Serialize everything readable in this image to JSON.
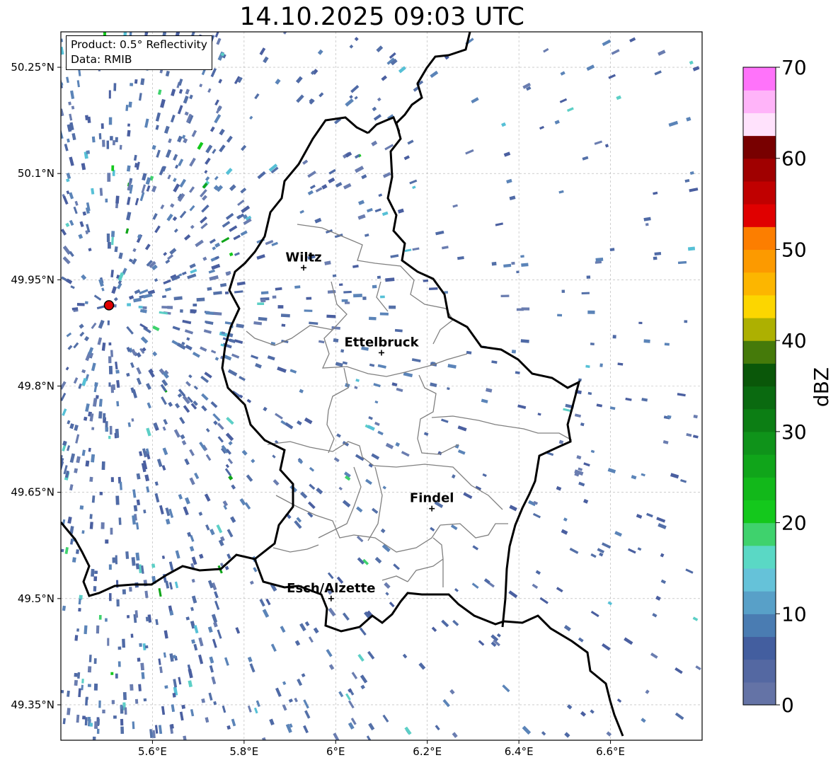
{
  "title": "14.10.2025 09:03 UTC",
  "info": {
    "product": "Product: 0.5° Reflectivity",
    "data": "Data: RMIB"
  },
  "map": {
    "lon_range": [
      5.4,
      6.8
    ],
    "lat_range": [
      49.3,
      50.3
    ],
    "x_ticks": [
      {
        "value": 5.6,
        "label": "5.6°E"
      },
      {
        "value": 5.8,
        "label": "5.8°E"
      },
      {
        "value": 6.0,
        "label": "6°E"
      },
      {
        "value": 6.2,
        "label": "6.2°E"
      },
      {
        "value": 6.4,
        "label": "6.4°E"
      },
      {
        "value": 6.6,
        "label": "6.6°E"
      }
    ],
    "y_ticks": [
      {
        "value": 50.25,
        "label": "50.25°N"
      },
      {
        "value": 50.1,
        "label": "50.1°N"
      },
      {
        "value": 49.95,
        "label": "49.95°N"
      },
      {
        "value": 49.8,
        "label": "49.8°N"
      },
      {
        "value": 49.65,
        "label": "49.65°N"
      },
      {
        "value": 49.5,
        "label": "49.5°N"
      },
      {
        "value": 49.35,
        "label": "49.35°N"
      }
    ],
    "cities": [
      {
        "name": "Wiltz",
        "lon": 5.93,
        "lat": 49.967
      },
      {
        "name": "Ettelbruck",
        "lon": 6.1,
        "lat": 49.847
      },
      {
        "name": "Findel",
        "lon": 6.21,
        "lat": 49.627
      },
      {
        "name": "Esch/Alzette",
        "lon": 5.99,
        "lat": 49.5
      }
    ],
    "radar_site": {
      "lon": 5.505,
      "lat": 49.914,
      "color": "#e00000"
    }
  },
  "colorbar": {
    "label": "dBZ",
    "min": 0,
    "max": 70,
    "tick_values": [
      0,
      10,
      20,
      30,
      40,
      50,
      60,
      70
    ],
    "colors": [
      "#6473a6",
      "#5468a2",
      "#435e9f",
      "#4a7cb2",
      "#58a0c8",
      "#65c2d9",
      "#5ad8c5",
      "#3fd26d",
      "#14c81c",
      "#12b81a",
      "#10a51a",
      "#0f931a",
      "#0c7e14",
      "#0a6a10",
      "#0a5709",
      "#457a0a",
      "#adb001",
      "#fcd600",
      "#fcb600",
      "#fc9a00",
      "#fc7e00",
      "#e00000",
      "#c00000",
      "#a00000",
      "#780000",
      "#ffe2fc",
      "#ffb4f9",
      "#ff73fa",
      "#ea35ef"
    ],
    "step": 2.5
  }
}
